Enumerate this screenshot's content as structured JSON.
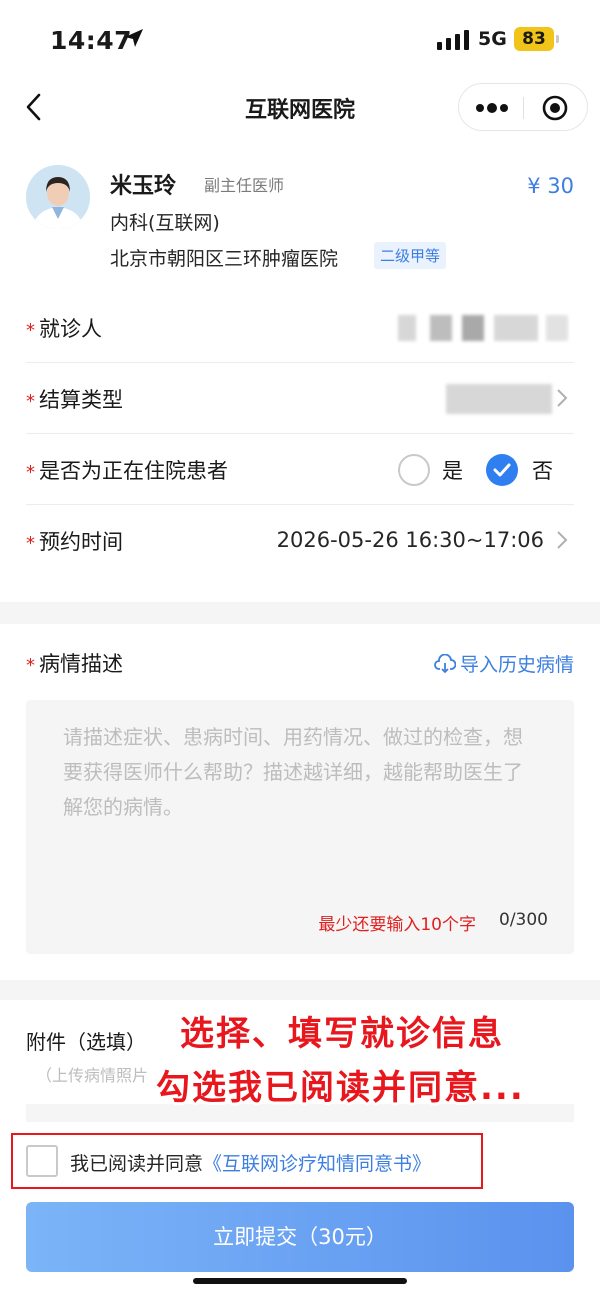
{
  "status_bar": {
    "time": "14:47",
    "network": "5G",
    "battery": "83"
  },
  "nav": {
    "title": "互联网医院"
  },
  "doctor": {
    "name": "米玉玲",
    "title": "副主任医师",
    "price": "¥ 30",
    "department": "内科(互联网)",
    "hospital": "北京市朝阳区三环肿瘤医院",
    "level": "二级甲等"
  },
  "form": {
    "required_mark": "*",
    "patient_label": "就诊人",
    "settlement_label": "结算类型",
    "inpatient_label": "是否为正在住院患者",
    "inpatient_yes": "是",
    "inpatient_no": "否",
    "inpatient_selected": "否",
    "appointment_label": "预约时间",
    "appointment_value": "2026-05-26 16:30~17:06"
  },
  "description": {
    "label": "病情描述",
    "import_label": "导入历史病情",
    "placeholder": "请描述症状、患病时间、用药情况、做过的检查，想要获得医师什么帮助？描述越详细，越能帮助医生了解您的病情。",
    "min_hint": "最少还要输入10个字",
    "count": "0/300"
  },
  "attachment": {
    "label": "附件（选填）",
    "hint": "（上传病情照片"
  },
  "annotation": {
    "line1": "选择、填写就诊信息",
    "line2": "勾选我已阅读并同意..."
  },
  "agreement": {
    "text": "我已阅读并同意",
    "link": "《互联网诊疗知情同意书》",
    "checked": false
  },
  "submit": {
    "label": "立即提交（30元）"
  },
  "colors": {
    "accent": "#3d7fe0",
    "required": "#e02020",
    "annotation": "#e8161d"
  }
}
